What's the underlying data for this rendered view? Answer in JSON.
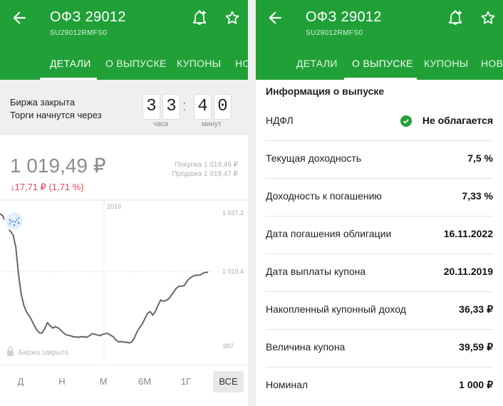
{
  "left": {
    "title": "ОФЗ 29012",
    "subtitle": "SU29012RMFS0",
    "tabs": [
      {
        "label": "ДЕТАЛИ",
        "active": true
      },
      {
        "label": "О ВЫПУСКЕ",
        "active": false
      },
      {
        "label": "КУПОНЫ",
        "active": false
      },
      {
        "label": "НО",
        "active": false
      }
    ],
    "status": {
      "line1": "Биржа закрыта",
      "line2": "Торги начнутся через",
      "digits": [
        "3",
        "3",
        "4",
        "0"
      ],
      "colon": ":",
      "hours_label": "часа",
      "minutes_label": "минут"
    },
    "quote": {
      "price": "1 019,49 ₽",
      "change": "↓17,71 ₽ (1,71 %)",
      "bid": "Покупка 1 019,49  ₽",
      "ask": "Продажа 1 019,47  ₽"
    },
    "chart_labels": {
      "year": "2019",
      "max": "1 037,2",
      "current": "1 019,4",
      "min": "997",
      "closed": "Биржа закрыта"
    },
    "chart_data": {
      "type": "line",
      "x": [
        0,
        1,
        2,
        3,
        4,
        5,
        6,
        7,
        8,
        9,
        10,
        11,
        12,
        13,
        14,
        15,
        16,
        17,
        18,
        19,
        20,
        21,
        22,
        23,
        24,
        25,
        26,
        27,
        28,
        29,
        30,
        31,
        32,
        33,
        34,
        35,
        36,
        37,
        38,
        39,
        40,
        41,
        42,
        43,
        44,
        45,
        46,
        47,
        48,
        49,
        50,
        51,
        52,
        53,
        54,
        55,
        56,
        57,
        58,
        59,
        60,
        61,
        62,
        63,
        64,
        65,
        66,
        67,
        68,
        69,
        70,
        71,
        72,
        73,
        74,
        75,
        76,
        77,
        78,
        79
      ],
      "values": [
        1037.2,
        1036.6,
        1034.9,
        1033.3,
        1031.8,
        1030.7,
        1027.0,
        1019.0,
        1013.0,
        1009.5,
        1007.5,
        1006.3,
        1004.9,
        1003.3,
        1001.9,
        1001.0,
        1001.0,
        1002.3,
        1004.1,
        1003.3,
        1002.5,
        1002.9,
        1002.6,
        1001.9,
        1001.1,
        1000.5,
        1000.3,
        1000.1,
        999.8,
        999.8,
        999.7,
        999.9,
        999.8,
        999.7,
        1000.2,
        1000.8,
        1000.6,
        1000.4,
        1000.2,
        1000.6,
        1000.8,
        1000.8,
        1000.3,
        999.9,
        998.9,
        998.3,
        998.4,
        998.2,
        998.2,
        998.0,
        998.3,
        999.4,
        1001.3,
        1002.6,
        1003.7,
        1005.3,
        1006.9,
        1007.5,
        1006.4,
        1007.5,
        1009.4,
        1011.0,
        1010.6,
        1010.9,
        1011.3,
        1012.4,
        1013.5,
        1014.6,
        1015.2,
        1015.2,
        1015.4,
        1016.7,
        1017.6,
        1018.1,
        1018.5,
        1018.5,
        1018.6,
        1019.1,
        1019.4,
        1019.4
      ],
      "ylim": [
        997,
        1037.2
      ],
      "grid": true
    },
    "periods": [
      {
        "label": "Д",
        "active": false
      },
      {
        "label": "Н",
        "active": false
      },
      {
        "label": "М",
        "active": false
      },
      {
        "label": "6М",
        "active": false
      },
      {
        "label": "1Г",
        "active": false
      },
      {
        "label": "ВСЕ",
        "active": true
      }
    ]
  },
  "right": {
    "title": "ОФЗ 29012",
    "subtitle": "SU29012RMFS0",
    "tabs": [
      {
        "label": "ДЕТАЛИ",
        "active": false
      },
      {
        "label": "О ВЫПУСКЕ",
        "active": true
      },
      {
        "label": "КУПОНЫ",
        "active": false
      },
      {
        "label": "НОВО",
        "active": false
      }
    ],
    "section_title": "Информация о выпуске",
    "rows": [
      {
        "label": "НДФЛ",
        "value": "Не облагается"
      },
      {
        "label": "Текущая доходность",
        "value": "7,5 %"
      },
      {
        "label": "Доходность к погашению",
        "value": "7,33 %"
      },
      {
        "label": "Дата погашения облигации",
        "value": "16.11.2022"
      },
      {
        "label": "Дата выплаты купона",
        "value": "20.11.2019"
      },
      {
        "label": "Накопленный купонный доход",
        "value": "36,33 ₽"
      },
      {
        "label": "Величина купона",
        "value": "39,59 ₽"
      },
      {
        "label": "Номинал",
        "value": "1 000 ₽"
      }
    ]
  },
  "colors": {
    "brand_green": "#21a038",
    "down_red": "#e5484d",
    "chart_line": "#666666"
  },
  "icons": [
    "back-arrow-icon",
    "notification-add-icon",
    "star-icon",
    "chart-analytics-icon",
    "lock-icon",
    "check-circle-icon"
  ]
}
